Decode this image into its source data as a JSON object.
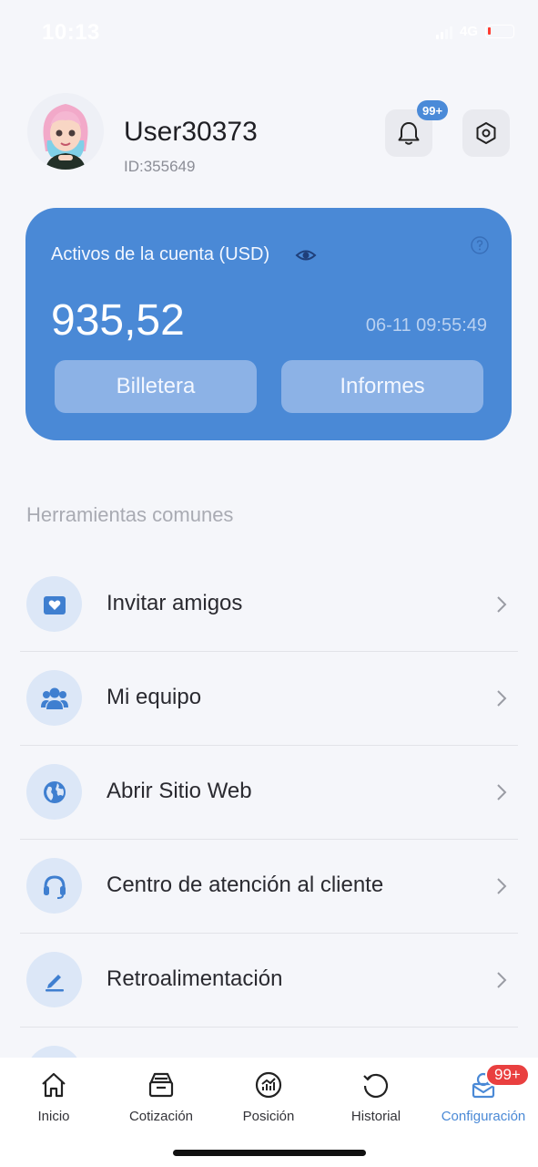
{
  "status_bar": {
    "time": "10:13",
    "network": "4G"
  },
  "header": {
    "username": "User30373",
    "user_id": "ID:355649",
    "notification_badge": "99+"
  },
  "asset_card": {
    "label": "Activos de la cuenta (USD)",
    "amount": "935,52",
    "timestamp": "06-11 09:55:49",
    "wallet_button": "Billetera",
    "reports_button": "Informes",
    "color": "#4a89d6"
  },
  "tools": {
    "title": "Herramientas comunes",
    "items": [
      {
        "label": "Invitar amigos",
        "icon": "envelope-heart-icon"
      },
      {
        "label": "Mi equipo",
        "icon": "team-icon"
      },
      {
        "label": "Abrir Sitio Web",
        "icon": "globe-icon"
      },
      {
        "label": "Centro de atención al cliente",
        "icon": "headset-icon"
      },
      {
        "label": "Retroalimentación",
        "icon": "pen-icon"
      }
    ]
  },
  "bottom_nav": {
    "items": [
      {
        "label": "Inicio",
        "icon": "home-icon"
      },
      {
        "label": "Cotización",
        "icon": "quote-box-icon"
      },
      {
        "label": "Posición",
        "icon": "position-chart-icon"
      },
      {
        "label": "Historial",
        "icon": "history-icon"
      },
      {
        "label": "Configuración",
        "icon": "profile-mail-icon"
      }
    ],
    "active_index": 4,
    "active_badge": "99+"
  }
}
